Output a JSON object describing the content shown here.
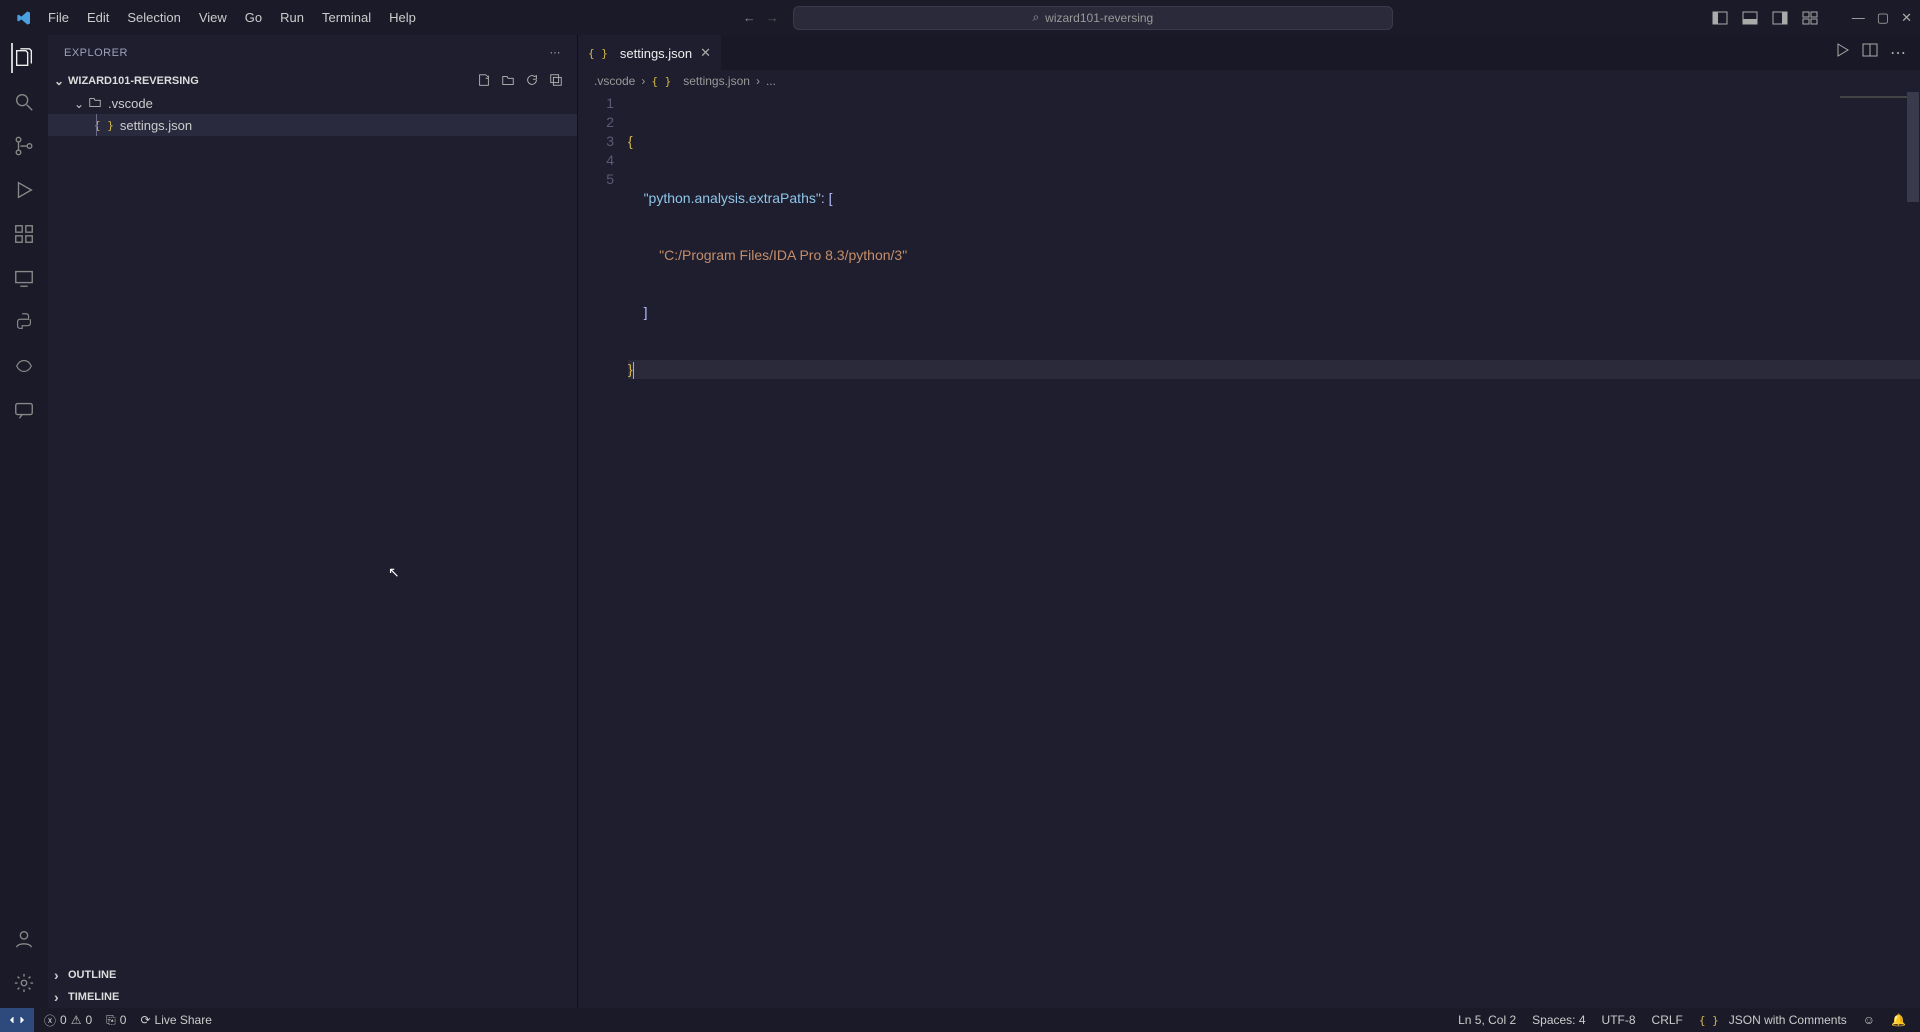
{
  "menu": [
    "File",
    "Edit",
    "Selection",
    "View",
    "Go",
    "Run",
    "Terminal",
    "Help"
  ],
  "command_center": {
    "workspace": "wizard101-reversing"
  },
  "sidebar": {
    "title": "Explorer",
    "folder": "WIZARD101-REVERSING",
    "tree": {
      "folder": ".vscode",
      "file": "settings.json"
    },
    "sections": [
      "Outline",
      "Timeline"
    ]
  },
  "tab": {
    "name": "settings.json"
  },
  "breadcrumb": {
    "a": ".vscode",
    "b": "settings.json",
    "c": "..."
  },
  "code": {
    "line1_open": "{",
    "line2_key": "\"python.analysis.extraPaths\"",
    "line2_sep": ": [",
    "line3_str": "\"C:/Program Files/IDA Pro 8.3/python/3\"",
    "line4_close": "]",
    "line5_close": "}"
  },
  "gutter": [
    "1",
    "2",
    "3",
    "4",
    "5"
  ],
  "status": {
    "errors": "0",
    "warnings": "0",
    "ports": "0",
    "live_share": "Live Share",
    "ln_col": "Ln 5, Col 2",
    "spaces": "Spaces: 4",
    "encoding": "UTF-8",
    "eol": "CRLF",
    "lang": "JSON with Comments"
  }
}
